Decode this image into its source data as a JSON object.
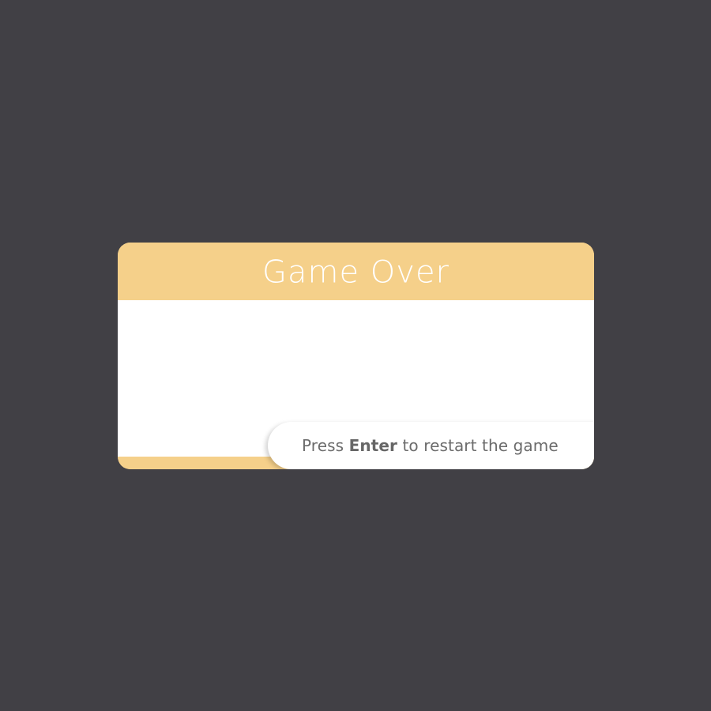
{
  "background_color": "#414045",
  "dialog": {
    "accent_color": "#f5d08a",
    "title": "Game Over",
    "restart_prompt": {
      "prefix": "Press ",
      "key": "Enter",
      "suffix": " to restart the game"
    }
  }
}
